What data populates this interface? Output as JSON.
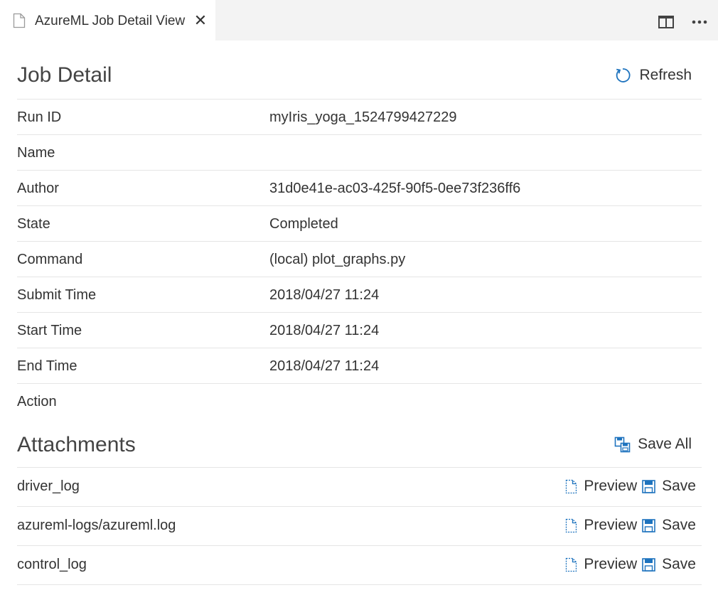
{
  "tab": {
    "title": "AzureML Job Detail View",
    "close_symbol": "✕"
  },
  "icons": {
    "tab_file": "file-icon",
    "split_editor": "split-editor-icon",
    "more_actions": "more-actions-icon",
    "refresh": "refresh-icon",
    "save_all": "save-all-icon",
    "preview": "preview-file-icon",
    "save": "save-disk-icon"
  },
  "colors": {
    "accent": "#1e73be"
  },
  "job_detail": {
    "title": "Job Detail",
    "refresh_label": "Refresh",
    "rows": [
      {
        "label": "Run ID",
        "value": "myIris_yoga_1524799427229"
      },
      {
        "label": "Name",
        "value": ""
      },
      {
        "label": "Author",
        "value": "31d0e41e-ac03-425f-90f5-0ee73f236ff6"
      },
      {
        "label": "State",
        "value": "Completed"
      },
      {
        "label": "Command",
        "value": "(local) plot_graphs.py"
      },
      {
        "label": "Submit Time",
        "value": "2018/04/27 11:24"
      },
      {
        "label": "Start Time",
        "value": "2018/04/27 11:24"
      },
      {
        "label": "End Time",
        "value": "2018/04/27 11:24"
      },
      {
        "label": "Action",
        "value": ""
      }
    ]
  },
  "attachments": {
    "title": "Attachments",
    "save_all_label": "Save All",
    "preview_label": "Preview",
    "save_label": "Save",
    "items": [
      {
        "name": "driver_log"
      },
      {
        "name": "azureml-logs/azureml.log"
      },
      {
        "name": "control_log"
      }
    ]
  }
}
